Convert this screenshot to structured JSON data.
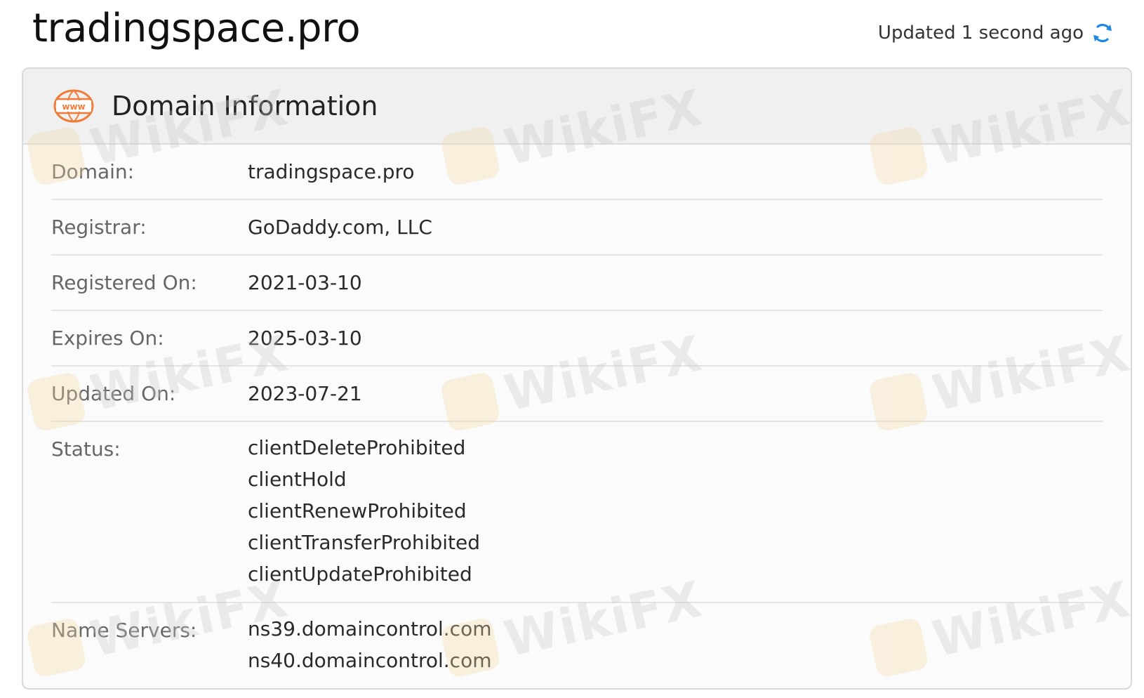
{
  "header": {
    "domain_title": "tradingspace.pro",
    "updated_text": "Updated 1 second ago"
  },
  "card": {
    "title": "Domain Information",
    "rows": [
      {
        "label": "Domain:",
        "value": "tradingspace.pro"
      },
      {
        "label": "Registrar:",
        "value": "GoDaddy.com, LLC"
      },
      {
        "label": "Registered On:",
        "value": "2021-03-10"
      },
      {
        "label": "Expires On:",
        "value": "2025-03-10"
      },
      {
        "label": "Updated On:",
        "value": "2023-07-21"
      }
    ],
    "status": {
      "label": "Status:",
      "values": [
        "clientDeleteProhibited",
        "clientHold",
        "clientRenewProhibited",
        "clientTransferProhibited",
        "clientUpdateProhibited"
      ]
    },
    "name_servers": {
      "label": "Name Servers:",
      "values": [
        "ns39.domaincontrol.com",
        "ns40.domaincontrol.com"
      ]
    }
  },
  "watermark": {
    "text": "WikiFX"
  },
  "icons": {
    "refresh": "refresh-icon",
    "www": "www-globe-icon"
  },
  "colors": {
    "accent_blue": "#1e88e5",
    "www_orange": "#f07c3a"
  }
}
